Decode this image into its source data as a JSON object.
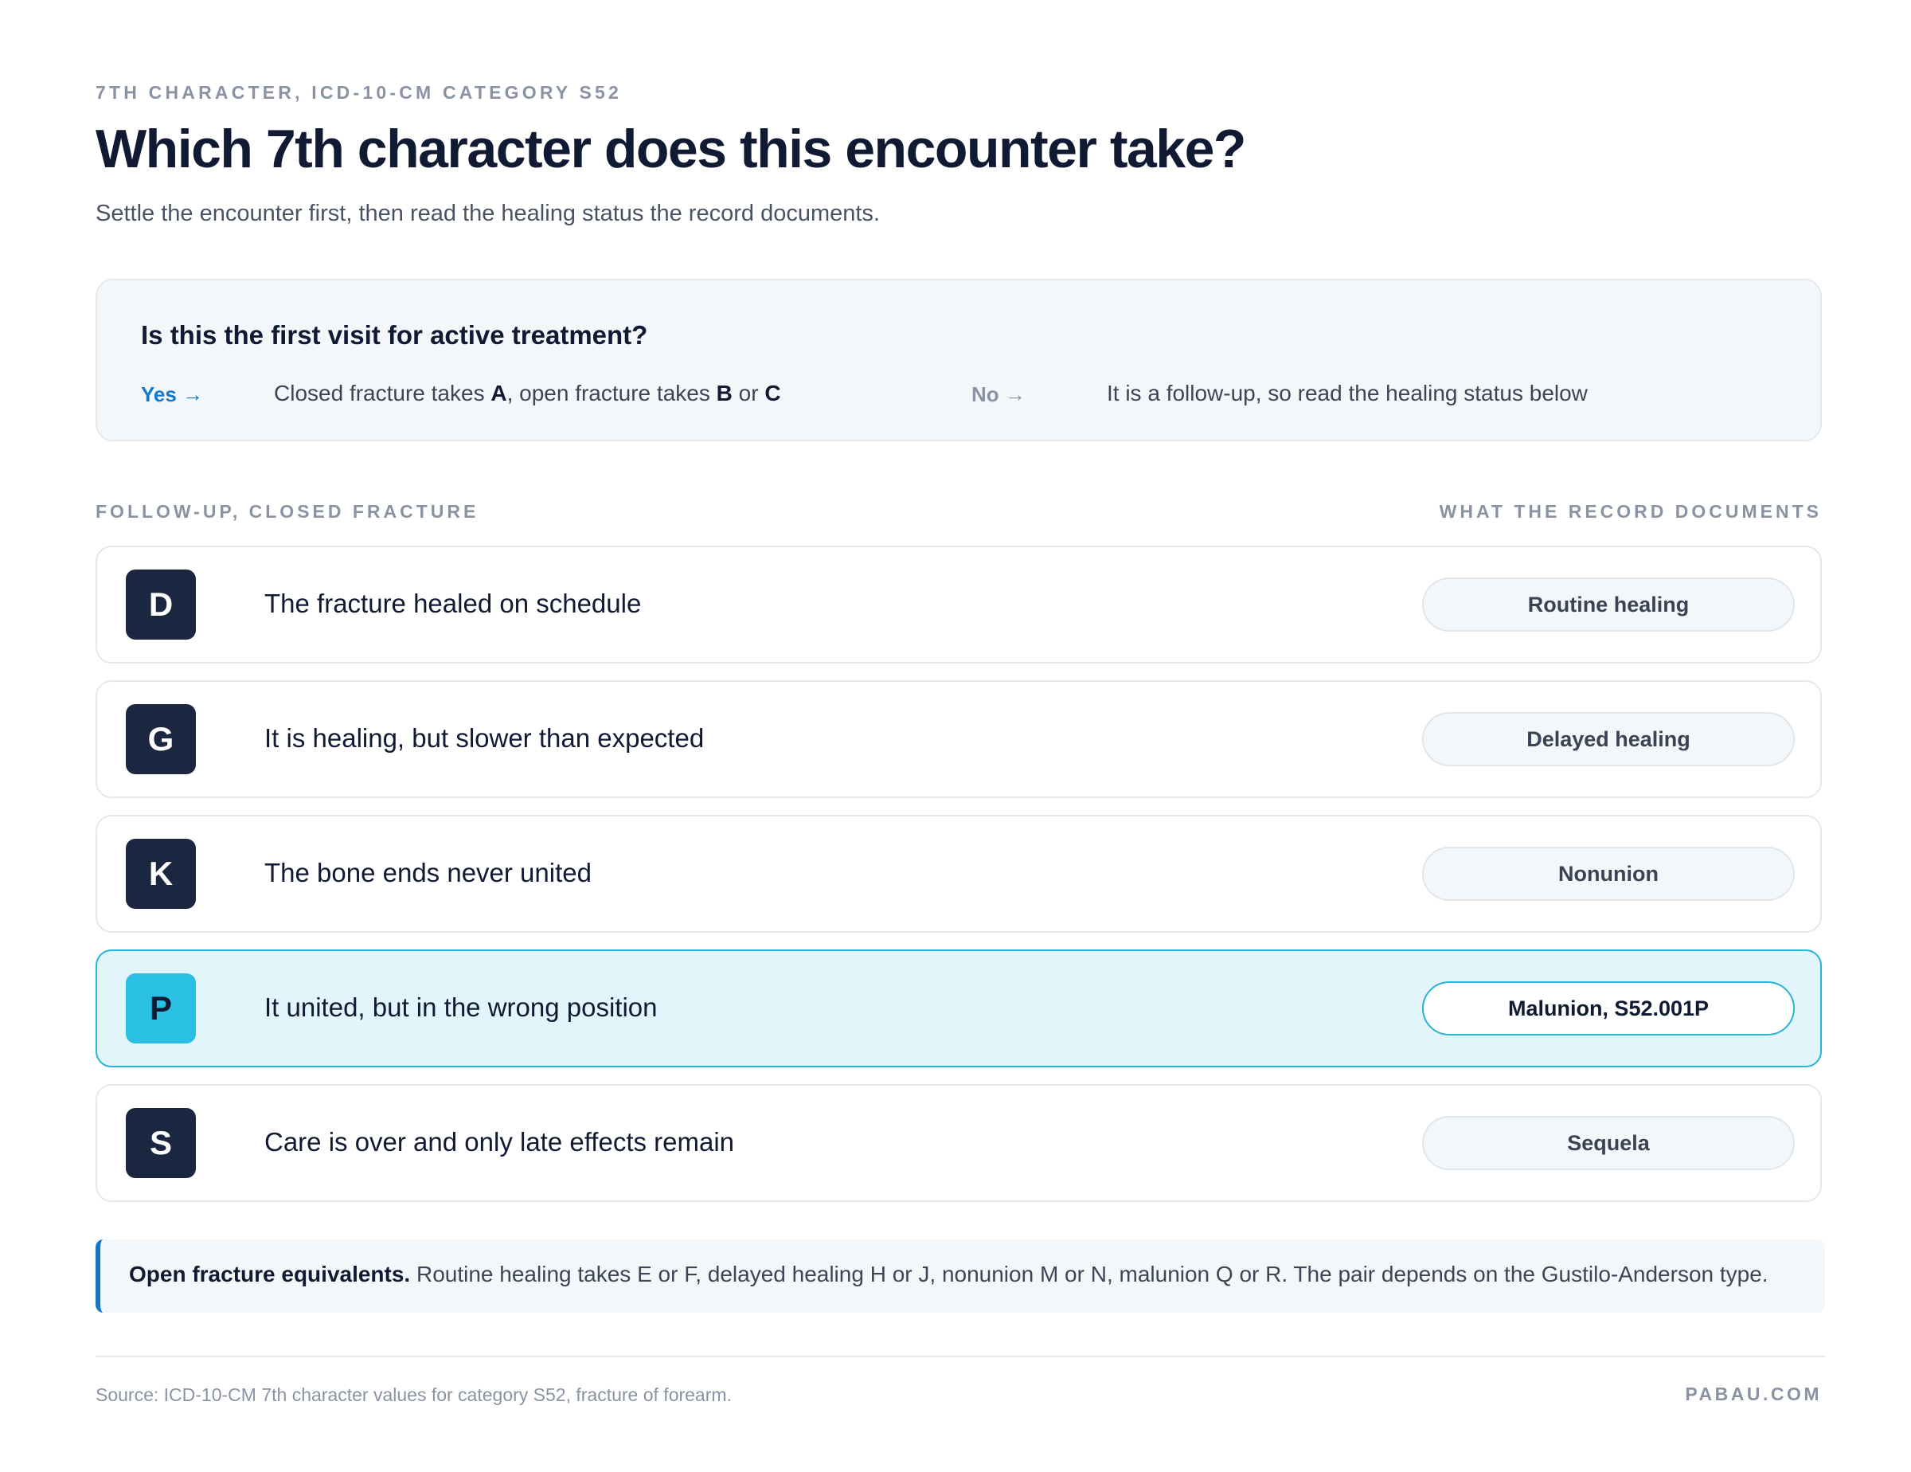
{
  "header": {
    "eyebrow": "7TH CHARACTER, ICD-10-CM CATEGORY S52",
    "title": "Which 7th character does this encounter take?",
    "subtitle": "Settle the encounter first, then read the healing status the record documents."
  },
  "question": {
    "text": "Is this the first visit for active treatment?",
    "yes_label": "Yes →",
    "yes_text_1": "Closed fracture takes ",
    "yes_code_a": "A",
    "yes_text_2": ", open fracture takes ",
    "yes_code_b": "B",
    "yes_text_3": " or ",
    "yes_code_c": "C",
    "no_label": "No →",
    "no_text": "It is a follow-up, so read the healing status below"
  },
  "section": {
    "left_label": "FOLLOW-UP, CLOSED FRACTURE",
    "right_label": "WHAT THE RECORD DOCUMENTS"
  },
  "rows": [
    {
      "letter": "D",
      "description": "The fracture healed on schedule",
      "status": "Routine healing"
    },
    {
      "letter": "G",
      "description": "It is healing, but slower than expected",
      "status": "Delayed healing"
    },
    {
      "letter": "K",
      "description": "The bone ends never united",
      "status": "Nonunion"
    },
    {
      "letter": "P",
      "description": "It united, but in the wrong position",
      "status": "Malunion, S52.001P"
    },
    {
      "letter": "S",
      "description": "Care is over and only late effects remain",
      "status": "Sequela"
    }
  ],
  "highlighted_row": "P",
  "note": {
    "bold": "Open fracture equivalents.",
    "text": " Routine healing takes E or F, delayed healing H or J, nonunion M or N, malunion Q or R. The pair depends on the Gustilo-Anderson type."
  },
  "footer": {
    "source": "Source: ICD-10-CM 7th character values for category S52, fracture of forearm.",
    "brand": "PABAU.COM"
  },
  "colors": {
    "accent": "#1478c8",
    "highlight_border": "#29b3d6",
    "highlight_fill": "#e2f5fa",
    "letter_badge": "#1b2740",
    "highlight_badge": "#29c0e3"
  }
}
